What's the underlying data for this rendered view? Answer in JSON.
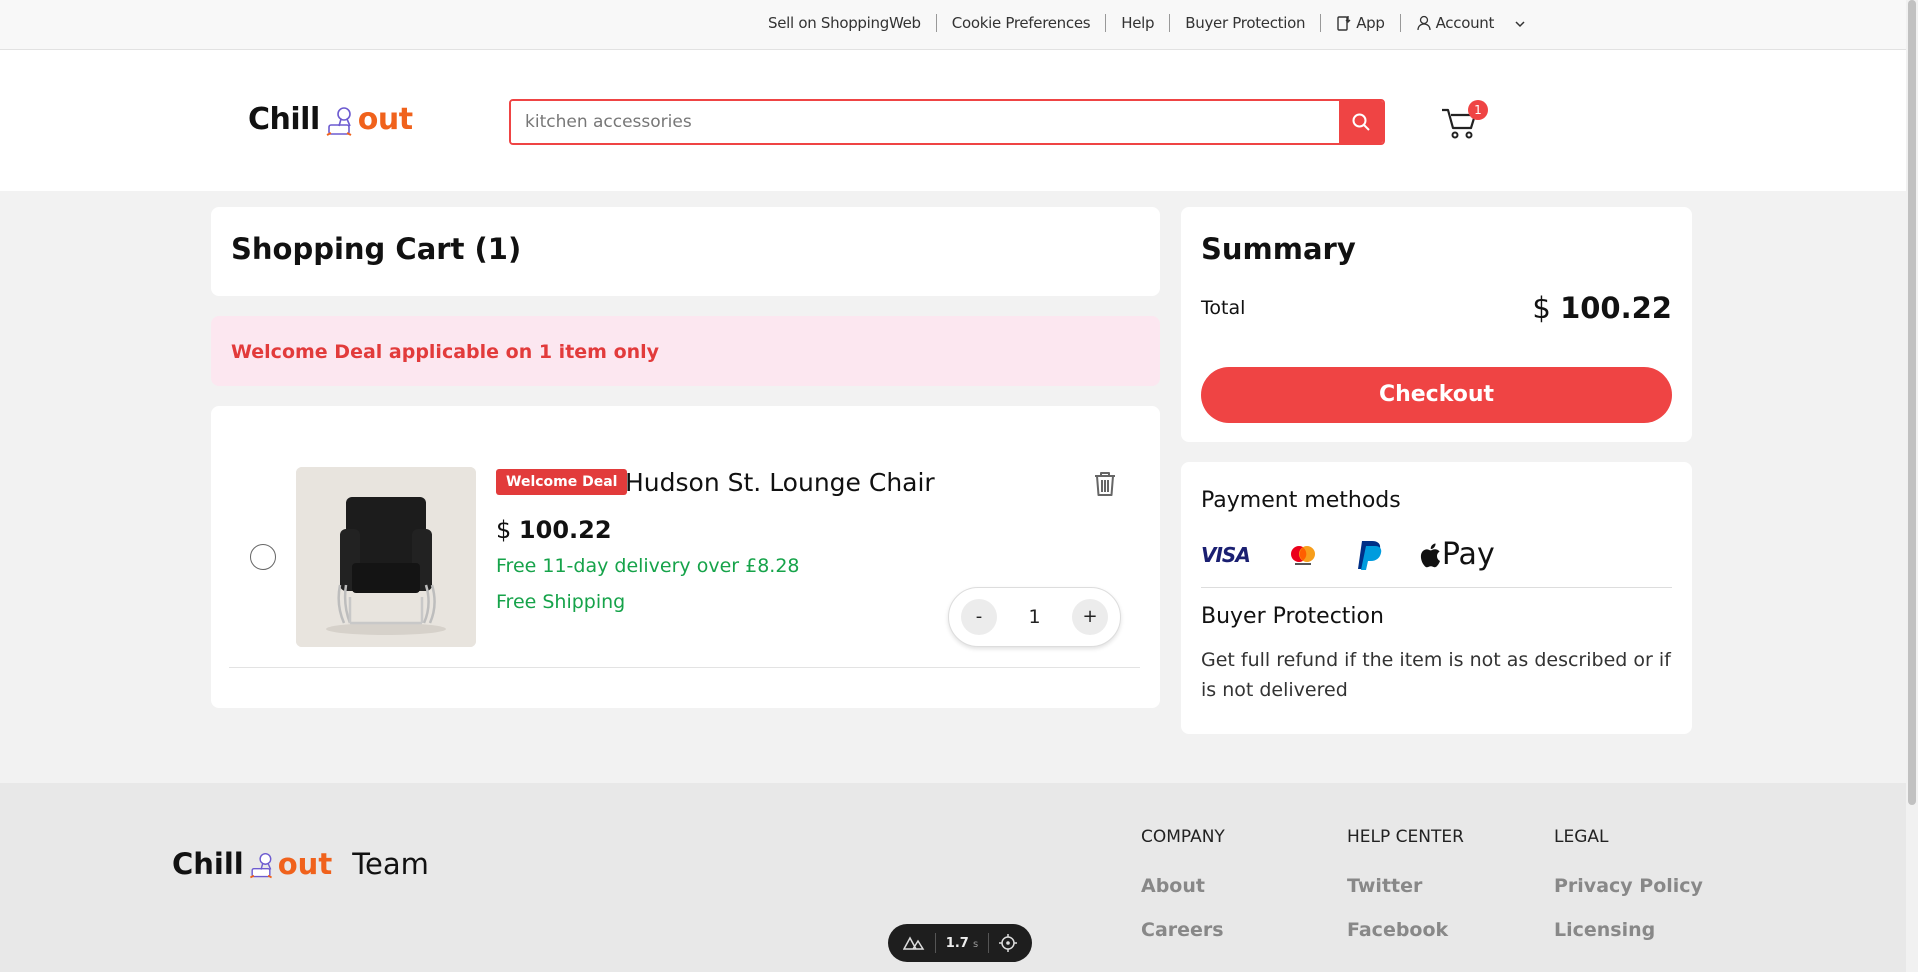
{
  "topbar": {
    "links": [
      "Sell on ShoppingWeb",
      "Cookie Preferences",
      "Help",
      "Buyer Protection"
    ],
    "app_label": "App",
    "account_label": "Account"
  },
  "header": {
    "logo_left": "Chill",
    "logo_right": "out",
    "search_placeholder": "kitchen accessories",
    "cart_count": "1"
  },
  "cart": {
    "title": "Shopping Cart (1)",
    "deal_banner": "Welcome Deal applicable on 1 item only",
    "item": {
      "tag": "Welcome Deal",
      "name": "Hudson St. Lounge Chair",
      "currency": "$",
      "price": "100.22",
      "delivery": "Free 11-day delivery over £8.28",
      "shipping": "Free Shipping",
      "decrement": "-",
      "quantity": "1",
      "increment": "+"
    }
  },
  "summary": {
    "title": "Summary",
    "total_label": "Total",
    "currency": "$",
    "total_value": "100.22",
    "checkout_label": "Checkout"
  },
  "payment": {
    "title": "Payment methods",
    "methods": [
      "VISA",
      "mastercard-icon",
      "paypal-icon",
      "Pay"
    ],
    "buyer_protection_title": "Buyer Protection",
    "buyer_protection_text": "Get full refund if the item is not as described or if is not delivered"
  },
  "footer": {
    "logo_left": "Chill",
    "logo_right": "out",
    "team": "Team",
    "columns": [
      {
        "heading": "COMPANY",
        "links": [
          "About",
          "Careers"
        ]
      },
      {
        "heading": "HELP CENTER",
        "links": [
          "Twitter",
          "Facebook"
        ]
      },
      {
        "heading": "LEGAL",
        "links": [
          "Privacy Policy",
          "Licensing"
        ]
      }
    ]
  },
  "dev_badge": {
    "time": "1.7",
    "unit": "s"
  },
  "colors": {
    "accent": "#ef4444",
    "brand_orange": "#f0621c",
    "success": "#16a34a",
    "deal_bg": "#fce7f0"
  }
}
